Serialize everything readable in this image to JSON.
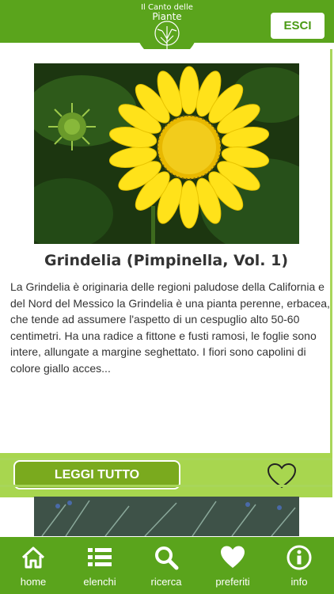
{
  "header": {
    "logo_line1": "Il Canto delle",
    "logo_line2": "Piante",
    "logout_label": "ESCI"
  },
  "card": {
    "title": "Grindelia (Pimpinella, Vol. 1)",
    "description": "La Grindelia è originaria delle regioni paludose della California e del Nord del Messico la Grindelia è una pianta perenne, erbacea, che tende ad assumere l'aspetto di un cespuglio alto 50-60 centimetri. Ha una radice a fittone e fusti ramosi, le foglie sono intere, allungate a margine seghettato. I fiori sono capolini di colore giallo acces...",
    "read_more_label": "LEGGI TUTTO",
    "favorite_icon": "heart-outline-icon"
  },
  "bottom_nav": [
    {
      "label": "home",
      "icon": "home-icon"
    },
    {
      "label": "elenchi",
      "icon": "list-icon"
    },
    {
      "label": "ricerca",
      "icon": "search-icon"
    },
    {
      "label": "preferiti",
      "icon": "heart-icon"
    },
    {
      "label": "info",
      "icon": "info-icon"
    }
  ],
  "colors": {
    "primary_green": "#5aa41c",
    "light_green": "#a8d64f",
    "button_green": "#7aaa1e"
  }
}
